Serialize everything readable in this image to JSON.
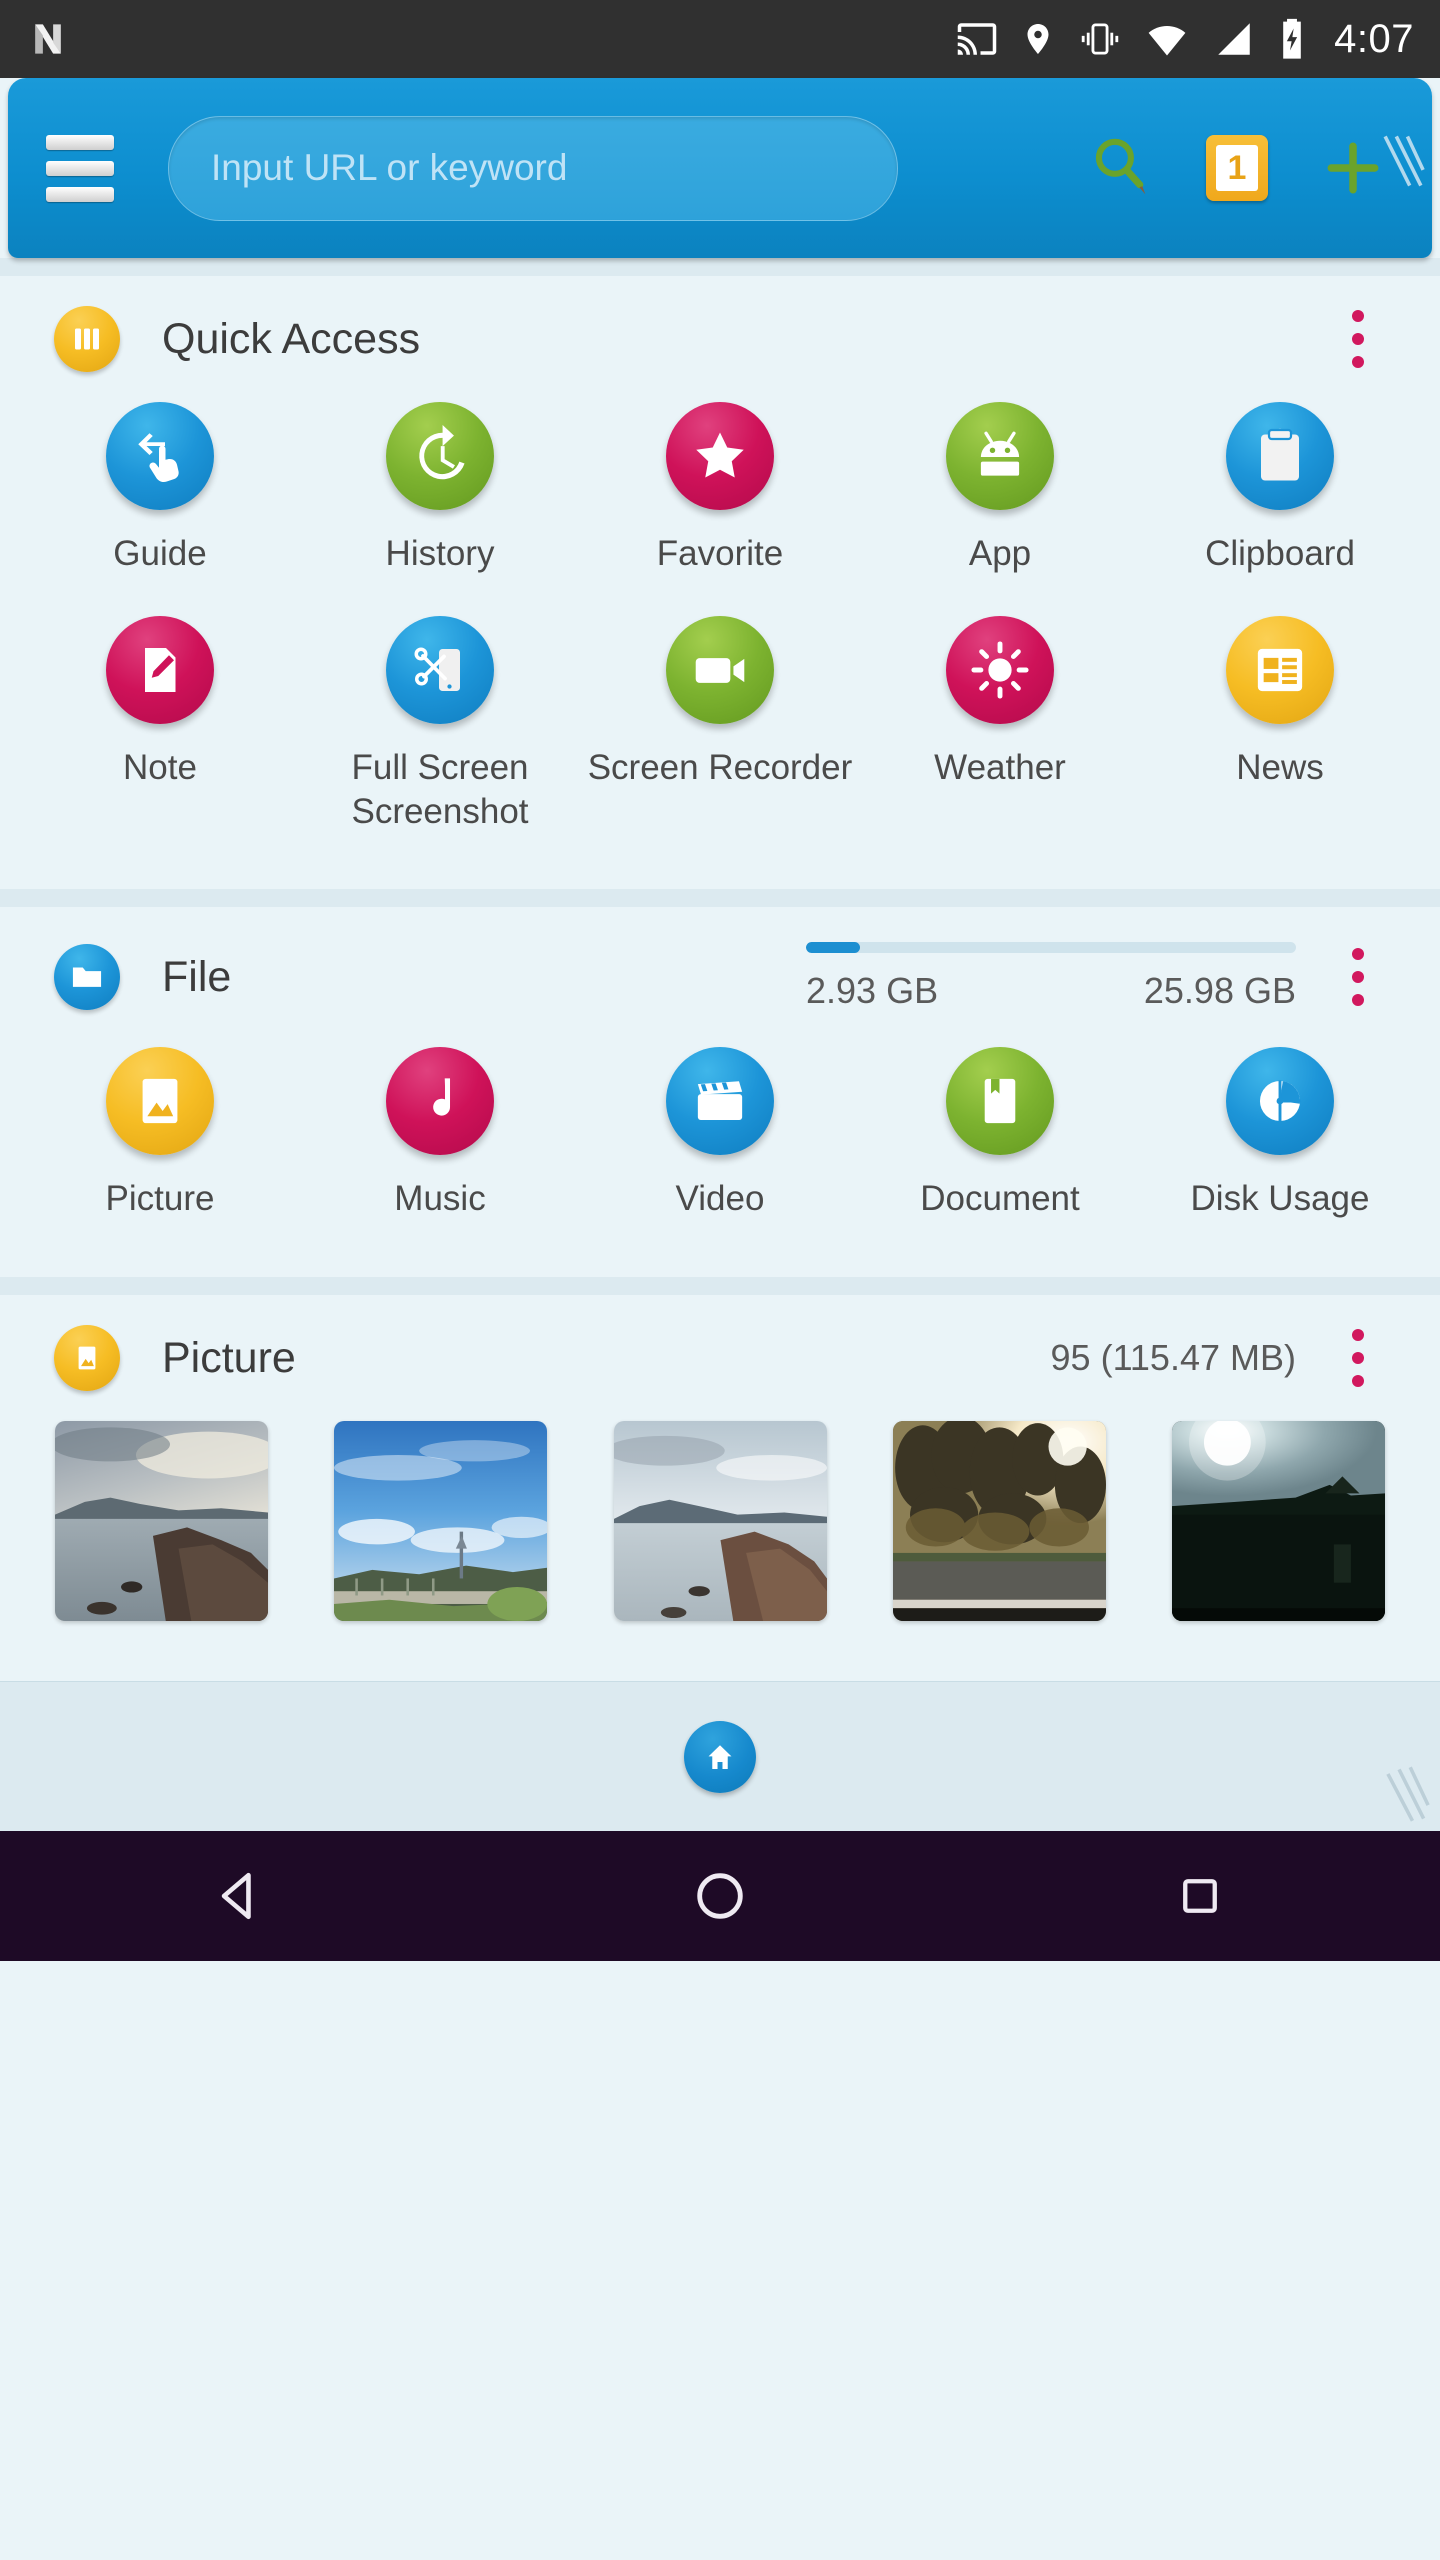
{
  "status_bar": {
    "time": "4:07",
    "icons": [
      "cast-icon",
      "location-icon",
      "vibrate-icon",
      "wifi-icon",
      "signal-icon",
      "battery-charging-icon"
    ]
  },
  "toolbar": {
    "menu_icon": "hamburger-menu-icon",
    "url_placeholder": "Input URL or keyword",
    "url_value": "",
    "search_icon": "search-magnifier-icon",
    "tab_count": "1",
    "new_tab_icon": "plus-icon",
    "accent_color": "#0d8ecf"
  },
  "quick_access": {
    "title": "Quick Access",
    "badge_icon": "grid-apps-icon",
    "overflow_icon": "kebab-menu-icon",
    "items": [
      {
        "label": "Guide",
        "icon": "swipe-gesture-icon",
        "color": "c-blue"
      },
      {
        "label": "History",
        "icon": "history-clock-icon",
        "color": "c-green"
      },
      {
        "label": "Favorite",
        "icon": "star-icon",
        "color": "c-red"
      },
      {
        "label": "App",
        "icon": "android-robot-icon",
        "color": "c-green"
      },
      {
        "label": "Clipboard",
        "icon": "clipboard-icon",
        "color": "c-blue"
      },
      {
        "label": "Note",
        "icon": "note-pencil-icon",
        "color": "c-red"
      },
      {
        "label": "Full Screen Screenshot",
        "icon": "scissors-phone-icon",
        "color": "c-blue"
      },
      {
        "label": "Screen Recorder",
        "icon": "camcorder-icon",
        "color": "c-green"
      },
      {
        "label": "Weather",
        "icon": "sun-icon",
        "color": "c-red"
      },
      {
        "label": "News",
        "icon": "news-article-icon",
        "color": "c-yellow"
      }
    ]
  },
  "file": {
    "title": "File",
    "badge_icon": "folder-icon",
    "overflow_icon": "kebab-menu-icon",
    "storage_used": "2.93 GB",
    "storage_total": "25.98 GB",
    "storage_percent": 11,
    "items": [
      {
        "label": "Picture",
        "icon": "image-icon",
        "color": "c-yellow"
      },
      {
        "label": "Music",
        "icon": "music-note-icon",
        "color": "c-red"
      },
      {
        "label": "Video",
        "icon": "clapperboard-icon",
        "color": "c-blue"
      },
      {
        "label": "Document",
        "icon": "book-icon",
        "color": "c-green"
      },
      {
        "label": "Disk Usage",
        "icon": "pie-chart-icon",
        "color": "c-blue"
      }
    ]
  },
  "picture": {
    "title": "Picture",
    "badge_icon": "image-icon",
    "overflow_icon": "kebab-menu-icon",
    "count_label": "95 (115.47 MB)",
    "thumbnails": [
      {
        "name": "coastal-seascape-overcast"
      },
      {
        "name": "blue-sky-park-tower"
      },
      {
        "name": "coastal-seascape-bright"
      },
      {
        "name": "roadside-trees-sunflare"
      },
      {
        "name": "dark-silhouette-sun"
      }
    ]
  },
  "bottom_bar": {
    "home_icon": "home-icon"
  },
  "nav_bar": {
    "back_icon": "back-triangle-icon",
    "home_icon": "home-circle-icon",
    "recents_icon": "recents-square-icon"
  }
}
